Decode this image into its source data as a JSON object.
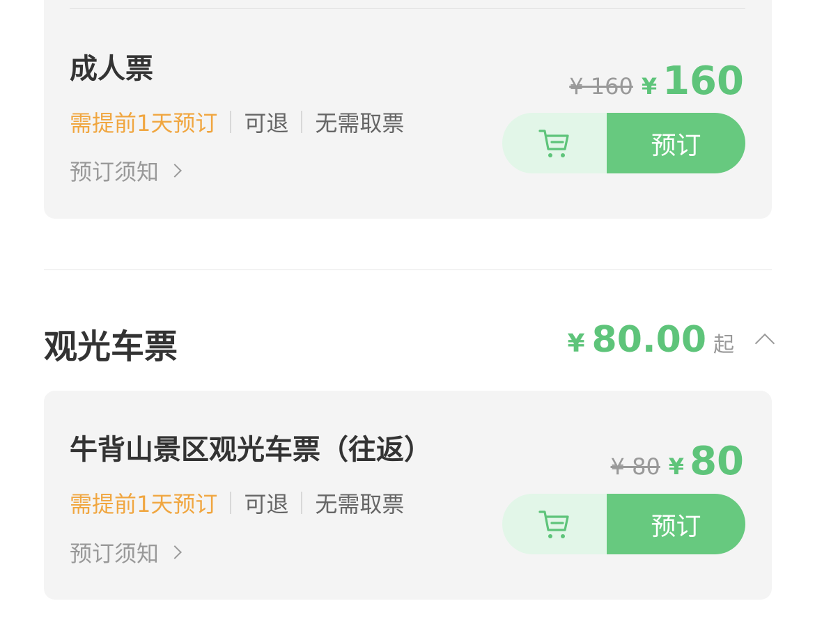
{
  "tickets_top": {
    "name": "成人票",
    "tag_advance": "需提前1天预订",
    "tag_refund": "可退",
    "tag_pickup": "无需取票",
    "notice": "预订须知",
    "original_price": "¥ 160",
    "sale_symbol": "¥",
    "sale_price": "160",
    "book_label": "预订",
    "cart_icon": "shopping-cart-icon"
  },
  "section": {
    "title": "观光车票",
    "price_symbol": "¥",
    "price": "80.00",
    "price_suffix": "起",
    "toggle_icon": "chevron-up-icon"
  },
  "tickets_bottom": {
    "name": "牛背山景区观光车票（往返）",
    "tag_advance": "需提前1天预订",
    "tag_refund": "可退",
    "tag_pickup": "无需取票",
    "notice": "预订须知",
    "original_price": "¥ 80",
    "sale_symbol": "¥",
    "sale_price": "80",
    "book_label": "预订",
    "cart_icon": "shopping-cart-icon"
  },
  "colors": {
    "accent": "#5ec47a",
    "book_button": "#67c97f",
    "cart_button_bg": "#e2f6e8",
    "advance_tag": "#f0a640",
    "card_bg": "#f4f4f4"
  }
}
